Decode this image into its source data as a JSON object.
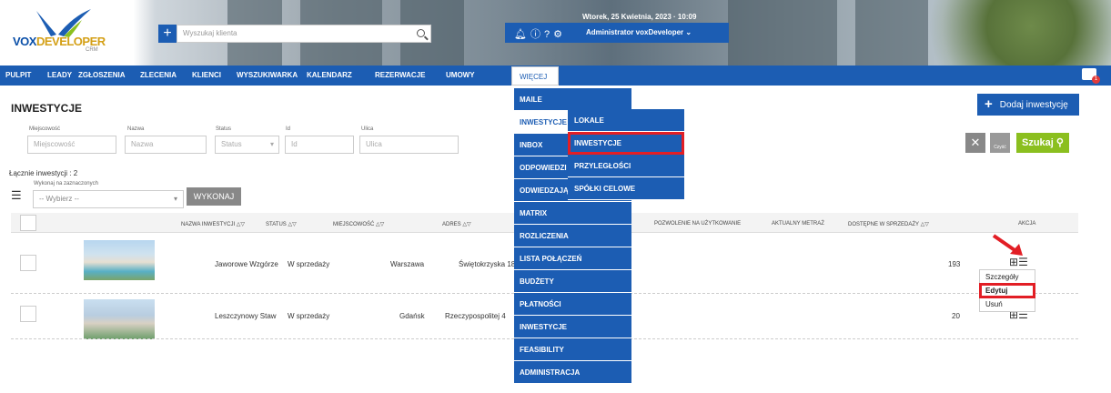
{
  "header": {
    "logo_vox": "VOX",
    "logo_developer": "DEVELOPER",
    "logo_crm": "CRM",
    "search_placeholder": "Wyszukaj klienta",
    "date": "Wtorek, 25 Kwietnia, 2023 · 10:09",
    "user": "Administrator voxDeveloper",
    "brand_color": "#1c5db3"
  },
  "nav": {
    "items": [
      "PULPIT",
      "LEADY",
      "ZGŁOSZENIA",
      "ZLECENIA",
      "KLIENCI",
      "WYSZUKIWARKA",
      "KALENDARZ",
      "REZERWACJE",
      "UMOWY"
    ],
    "more": "WIĘCEJ",
    "badge": "1"
  },
  "page": {
    "title": "INWESTYCJE",
    "add_button": "Dodaj inwestycję",
    "filters": [
      {
        "label": "Miejscowość",
        "placeholder": "Miejscowość"
      },
      {
        "label": "Nazwa",
        "placeholder": "Nazwa"
      },
      {
        "label": "Status",
        "placeholder": "Status"
      },
      {
        "label": "Id",
        "placeholder": "Id"
      },
      {
        "label": "Ulica",
        "placeholder": "Ulica"
      }
    ],
    "clear_label": "Czyść",
    "search_button": "Szukaj",
    "total": "Łącznie inwestycji : 2",
    "bulk_label": "Wykonaj na zaznaczonych",
    "bulk_select": "-- Wybierz --",
    "bulk_button": "WYKONAJ"
  },
  "table": {
    "columns": [
      "NAZWA INWESTYCJI",
      "STATUS",
      "MIEJSCOWOŚĆ",
      "ADRES",
      "POZWOLENIE NA UŻYTKOWANIE",
      "AKTUALNY METRAŻ",
      "DOSTĘPNE W SPRZEDAŻY",
      "AKCJA"
    ],
    "rows": [
      {
        "name": "Jaworowe Wzgórze",
        "status": "W sprzedaży",
        "city": "Warszawa",
        "address": "Świętokrzyska 18",
        "available": "193"
      },
      {
        "name": "Leszczynowy Staw",
        "status": "W sprzedaży",
        "city": "Gdańsk",
        "address": "Rzeczypospolitej 4",
        "available": "20"
      }
    ]
  },
  "menu_more": [
    "MAILE",
    "INWESTYCJE",
    "INBOX",
    "ODPOWIEDZI Z",
    "ODWIEDZAJĄCY",
    "MATRIX",
    "ROZLICZENIA",
    "LISTA POŁĄCZEŃ",
    "BUDŻETY",
    "PŁATNOŚCI",
    "INWESTYCJE",
    "FEASIBILITY",
    "ADMINISTRACJA"
  ],
  "submenu": [
    "LOKALE",
    "INWESTYCJE",
    "PRZYLEGŁOŚCI",
    "SPÓŁKI CELOWE"
  ],
  "action_popup": [
    "Szczegóły",
    "Edytuj",
    "Usuń"
  ],
  "highlight_color": "#e21e25"
}
